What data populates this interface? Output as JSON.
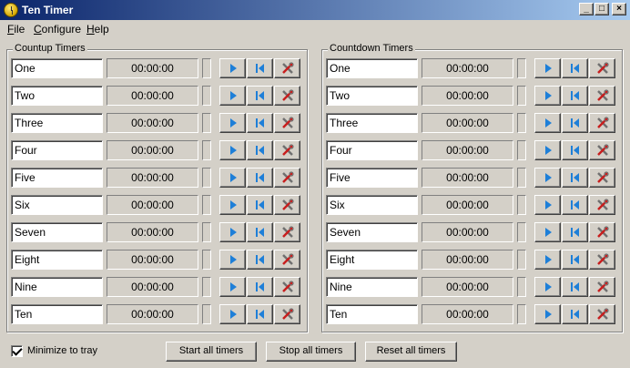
{
  "window": {
    "title": "Ten Timer"
  },
  "menu": [
    {
      "label": "File",
      "hotkey": "F",
      "rest": "ile"
    },
    {
      "label": "Configure",
      "hotkey": "C",
      "rest": "onfigure"
    },
    {
      "label": "Help",
      "hotkey": "H",
      "rest": "elp"
    }
  ],
  "countup": {
    "title": "Countup Timers",
    "timers": [
      {
        "name": "One",
        "time": "00:00:00"
      },
      {
        "name": "Two",
        "time": "00:00:00"
      },
      {
        "name": "Three",
        "time": "00:00:00"
      },
      {
        "name": "Four",
        "time": "00:00:00"
      },
      {
        "name": "Five",
        "time": "00:00:00"
      },
      {
        "name": "Six",
        "time": "00:00:00"
      },
      {
        "name": "Seven",
        "time": "00:00:00"
      },
      {
        "name": "Eight",
        "time": "00:00:00"
      },
      {
        "name": "Nine",
        "time": "00:00:00"
      },
      {
        "name": "Ten",
        "time": "00:00:00"
      }
    ]
  },
  "countdown": {
    "title": "Countdown Timers",
    "timers": [
      {
        "name": "One",
        "time": "00:00:00"
      },
      {
        "name": "Two",
        "time": "00:00:00"
      },
      {
        "name": "Three",
        "time": "00:00:00"
      },
      {
        "name": "Four",
        "time": "00:00:00"
      },
      {
        "name": "Five",
        "time": "00:00:00"
      },
      {
        "name": "Six",
        "time": "00:00:00"
      },
      {
        "name": "Seven",
        "time": "00:00:00"
      },
      {
        "name": "Eight",
        "time": "00:00:00"
      },
      {
        "name": "Nine",
        "time": "00:00:00"
      },
      {
        "name": "Ten",
        "time": "00:00:00"
      }
    ]
  },
  "footer": {
    "minimize_label": "Minimize to tray",
    "minimize_checked": true,
    "start_all": "Start all timers",
    "stop_all": "Stop all timers",
    "reset_all": "Reset all timers"
  },
  "icons": {
    "play": "play-icon",
    "reset": "skip-back-icon",
    "settings": "tools-icon"
  },
  "colors": {
    "title_start": "#0a246a",
    "title_end": "#a6caf0",
    "face": "#d4d0c8",
    "icon_blue": "#1e7fd8",
    "icon_red": "#c81e1e"
  }
}
